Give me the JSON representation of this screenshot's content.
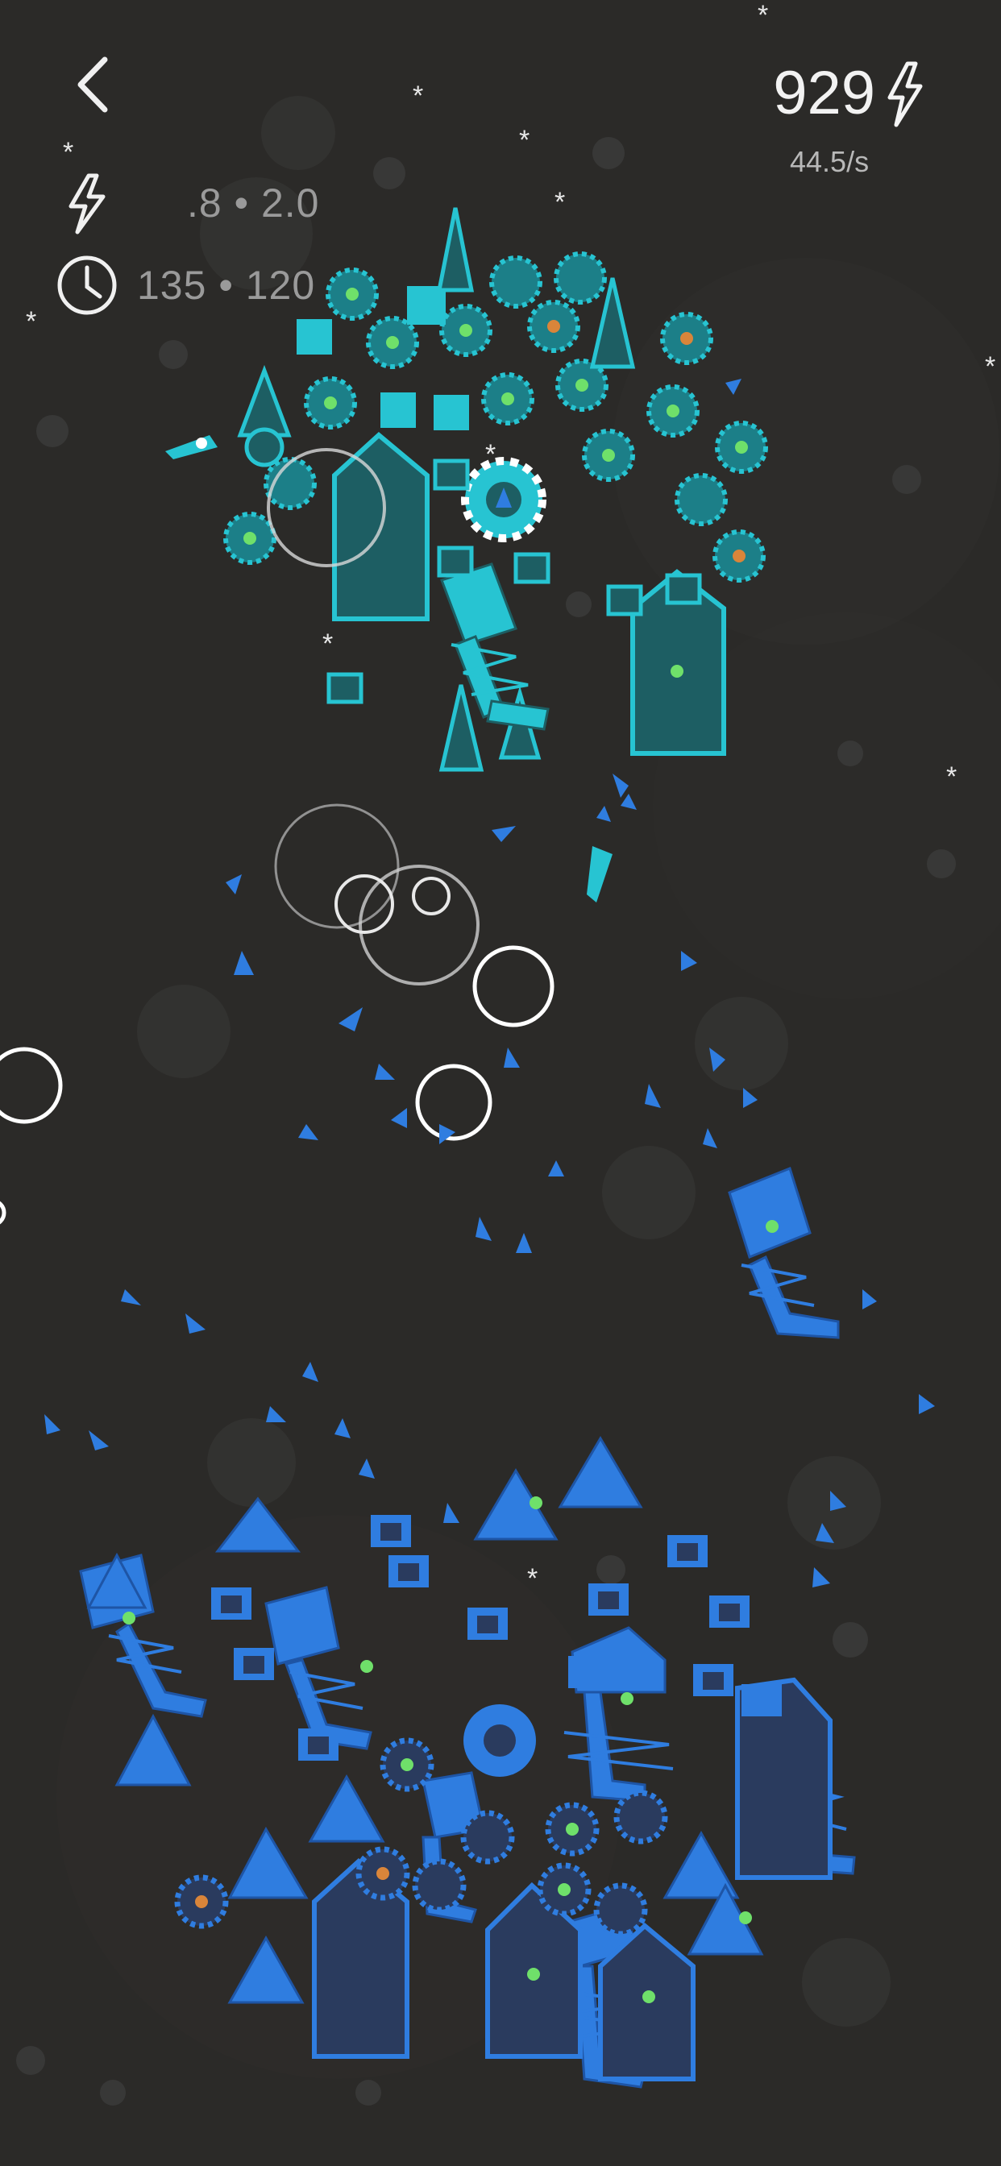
{
  "hud": {
    "back_icon": "chevron-left-icon",
    "power_icon": "lightning-bolt-icon",
    "power_stat": ".8 • 2.0",
    "time_icon": "clock-icon",
    "time_stat": "135 • 120",
    "energy_count": "929",
    "energy_icon": "lightning-bolt-icon",
    "energy_rate": "44.5/s"
  },
  "colors": {
    "background": "#2b2a28",
    "cyan_team": "#27c4d2",
    "cyan_dark": "#1d5e63",
    "blue_team": "#2f7de0",
    "blue_dark": "#2a3b5e",
    "green_core": "#6fe06a",
    "orange_core": "#d9853a",
    "white": "#ffffff"
  }
}
